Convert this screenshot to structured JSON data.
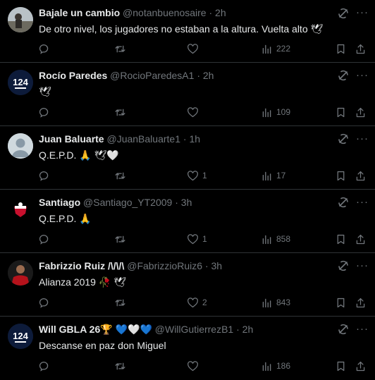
{
  "tweets": [
    {
      "name": "Bajale un cambio",
      "handle": "@notanbuenosaire",
      "sep": "·",
      "time": "2h",
      "text": "De otro nivel, los jugadores no estaban a la altura. Vuelta alto 🕊",
      "avatar": "photo-avatar",
      "likes": "",
      "views": "222"
    },
    {
      "name": "Rocío Paredes",
      "handle": "@RocioParedesA1",
      "sep": "·",
      "time": "2h",
      "text": "🕊",
      "avatar": "124-badge-avatar",
      "likes": "",
      "views": "109"
    },
    {
      "name": "Juan Baluarte",
      "handle": "@JuanBaluarte1",
      "sep": "·",
      "time": "1h",
      "text": "Q.E.P.D. 🙏 🕊🤍",
      "avatar": "default-avatar",
      "likes": "1",
      "views": "17"
    },
    {
      "name": "Santiago",
      "handle": "@Santiago_YT2009",
      "sep": "·",
      "time": "3h",
      "text": "Q.E.P.D. 🙏",
      "avatar": "club-crest-avatar",
      "likes": "1",
      "views": "858"
    },
    {
      "name": "Fabrizzio Ruiz /\\/\\/\\",
      "handle": "@FabrizzioRuiz6",
      "sep": "·",
      "time": "3h",
      "text": "Alianza 2019 🥀 🕊",
      "avatar": "player-avatar",
      "likes": "2",
      "views": "843"
    },
    {
      "name": "Will GBLA 26🏆 💙🤍💙",
      "handle": "@WillGutierrezB1",
      "sep": "·",
      "time": "2h",
      "text": "Descanse en paz don Miguel",
      "avatar": "124-badge-avatar",
      "likes": "",
      "views": "186"
    }
  ],
  "more_glyph": "···",
  "colors": {
    "background": "#000000",
    "text": "#e7e9ea",
    "muted": "#71767b",
    "divider": "#2f3336"
  }
}
